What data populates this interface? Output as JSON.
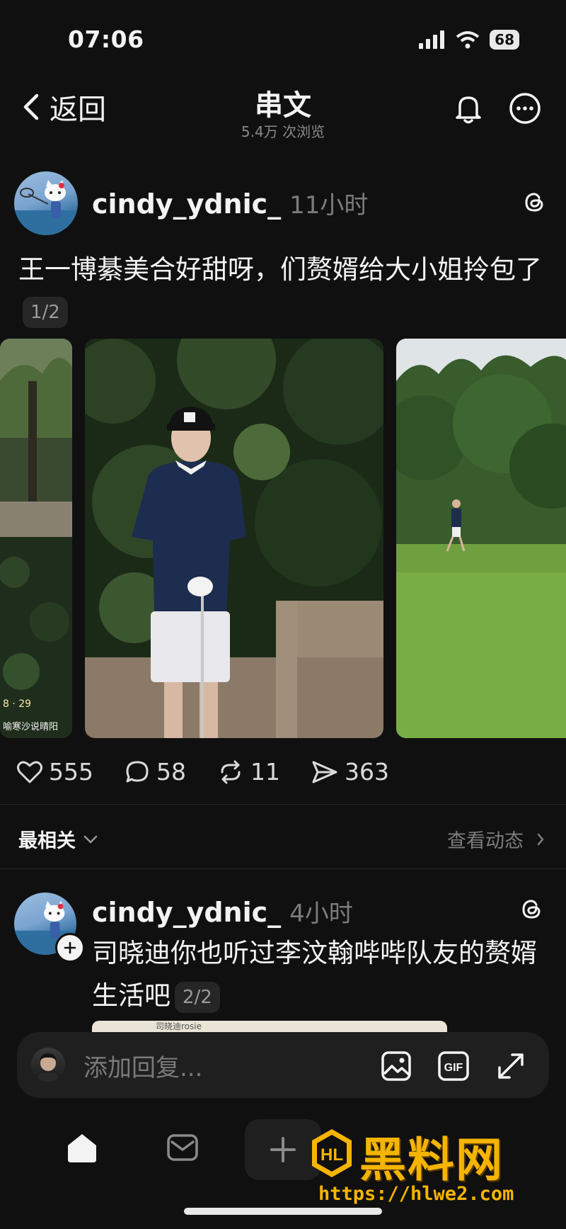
{
  "status_bar": {
    "time": "07:06",
    "battery": "68"
  },
  "header": {
    "back_label": "返回",
    "title": "串文",
    "views": "5.4万 次浏览"
  },
  "post": {
    "username": "cindy_ydnic_",
    "time": "11小时",
    "text": "王一博綦美合好甜呀，们赘婿给大小姐拎包了",
    "page": "1/2",
    "photo_caption": "8 · 29",
    "photo_watermark": "喻寒沙说晴阳",
    "stats": {
      "likes": "555",
      "comments": "58",
      "reposts": "11",
      "shares": "363"
    }
  },
  "sort": {
    "label": "最相关",
    "activity_link": "查看动态"
  },
  "reply": {
    "username": "cindy_ydnic_",
    "time": "4小时",
    "text": "司晓迪你也听过李汶翰哔哔队友的赘婿生活吧",
    "page": "2/2",
    "embed_preview": "司晓迪rosie"
  },
  "composer": {
    "placeholder": "添加回复..."
  },
  "watermark": {
    "brand": "黑料网",
    "url": "https://hlwe2.com"
  },
  "colors": {
    "background": "#101010",
    "text": "#f3f3f3",
    "muted": "#7c7c7c",
    "watermark": "#f5b400"
  }
}
